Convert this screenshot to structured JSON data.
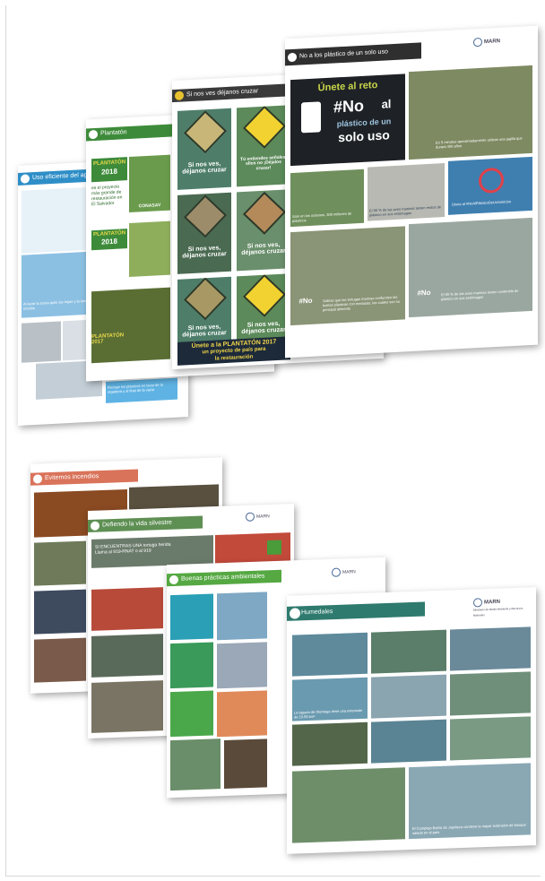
{
  "posters_top": {
    "water": {
      "header": "Uso eficiente del agua",
      "cap1": "Al lavar la acera quite las hojas y la tierra con la escoba",
      "cap2": "Recoge los plásticos en lavar de la regadera y al final de la vacía"
    },
    "plantaton": {
      "header": "Plantatón",
      "badge1_line1": "PLANTATÓN",
      "badge1_line2": "2018",
      "badge1_text": "es el proyecto más grande de restauración en El Salvador",
      "badge2_line1": "PLANTATÓN",
      "badge2_line2": "2018",
      "bottom_text": "PLANTATÓN 2017",
      "brand": "CONASAV"
    },
    "wildlife": {
      "header": "Si nos ves déjanos cruzar",
      "tile_text": "Si nos ves, déjanos cruzar",
      "sign_text": "Tú entiendes señales, ellos no ¡Déjalos cruzar!",
      "banner_line1": "Únete a la PLANTATÓN 2017",
      "banner_line2": "un proyecto de país para",
      "banner_line3": "la restauración"
    },
    "plastic": {
      "header": "No a los plástico de un solo uso",
      "challenge_top": "Únete al reto",
      "hash_no": "#No",
      "al": "al",
      "plastic": "plástico de un",
      "solo_uso": "solo uso",
      "cap_a": "En 5 minutos aproximadamente utilizas una pajilla que durará 400 años",
      "cap_b": "Solo en los océanos, 300 millones de plásticos",
      "cap_c": "El 90 % de las aves marinas tienen restos de plástico en sus estómagos",
      "cap_d": "Únete al #NoAlPlásticoDeUnSoloUso",
      "cap_e": "Sabías que las tortugas marinas confunden las bolsas plásticas con medusas, las cuales son su principal alimento",
      "cap_f": "El 90 % de las aves marinas tienen contenido de plástico en sus estómagos",
      "logo": "MARN"
    }
  },
  "posters_bottom": {
    "fires": {
      "header": "Evitemos incendios"
    },
    "wildlife2": {
      "header": "Defiendo la vida silvestre",
      "cap": "SI ENCUENTRAS UNA tortuga herida Llama al 919-RNAT o al 919"
    },
    "practices": {
      "header": "Buenas prácticas ambientales"
    },
    "wetlands": {
      "header": "Humedales",
      "cap1": "La laguna de Olomega tiene una extensión de 23.05 km²",
      "cap2": "El Complejo Bahía de Jiquilisco contiene la mayor extensión de bosque salado en el país",
      "logo": "MARN",
      "logo_sub": "Ministerio de Medio Ambiente y Recursos Naturales"
    }
  },
  "colors": {
    "water_blue": "#2e8ec7",
    "plantaton_green": "#3d8b3a",
    "dark_header": "#3a3a3a",
    "fire_orange": "#d9735a",
    "practice_green": "#55a842",
    "wetland_teal": "#2f7a6e"
  }
}
